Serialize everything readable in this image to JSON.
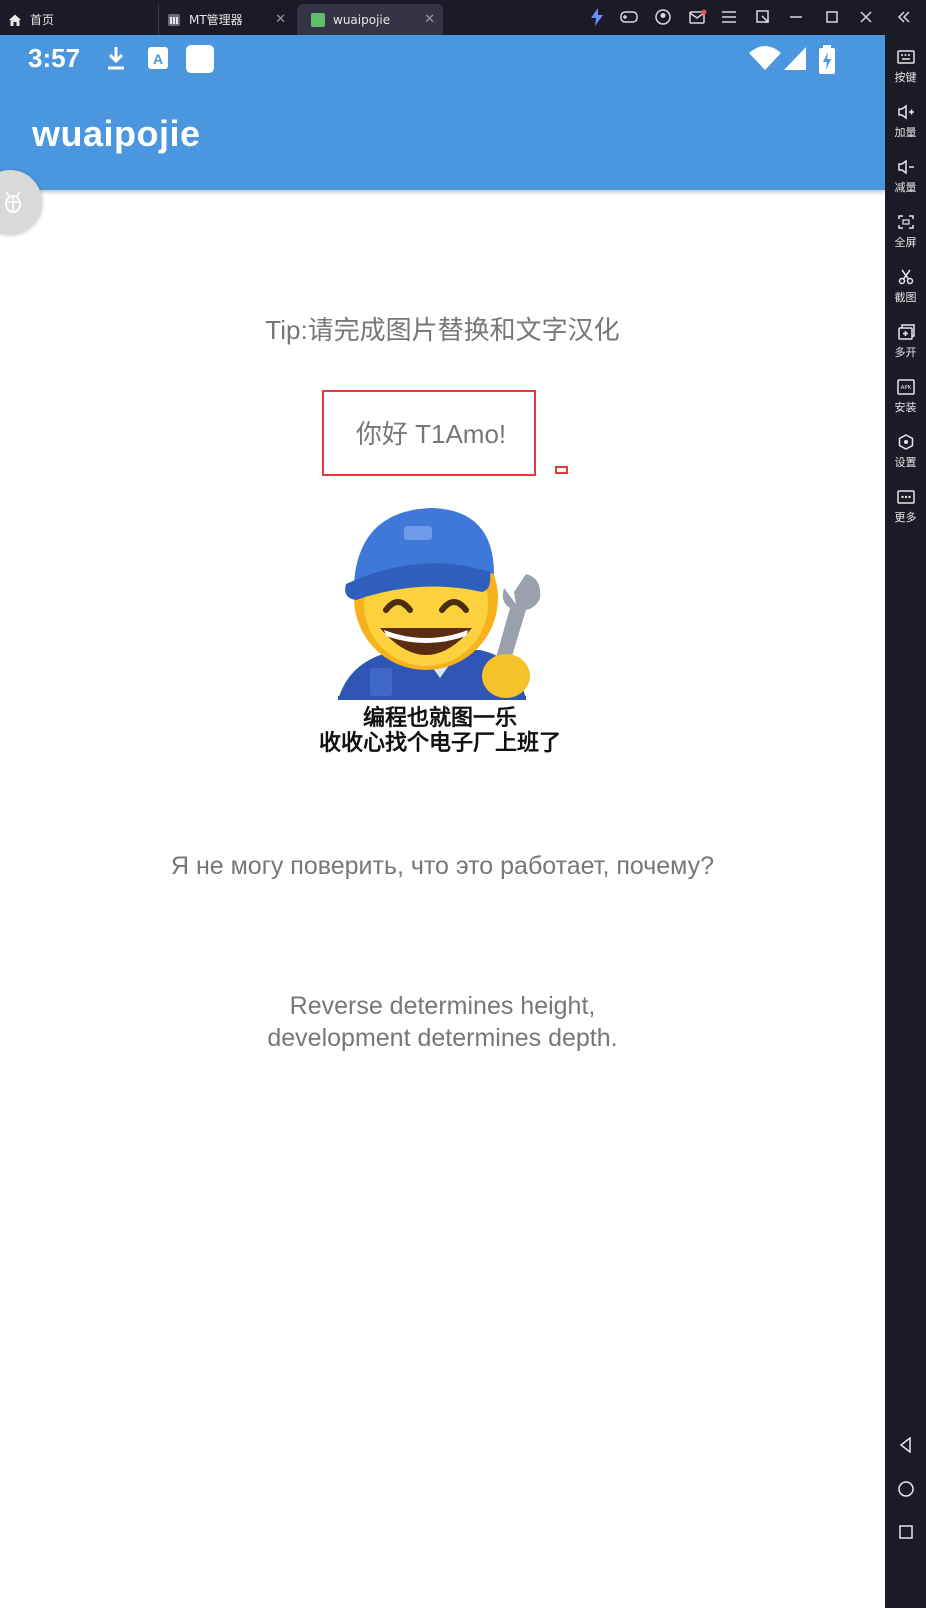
{
  "emulator": {
    "tabs": [
      {
        "label": "首页",
        "icon": "home-icon"
      },
      {
        "label": "MT管理器",
        "icon": "mt-manager-app-icon"
      },
      {
        "label": "wuaipojie",
        "icon": "android-app-icon"
      }
    ],
    "sidebar": [
      {
        "label": "按键",
        "icon": "keyboard-icon"
      },
      {
        "label": "加量",
        "icon": "volume-up-icon"
      },
      {
        "label": "减量",
        "icon": "volume-down-icon"
      },
      {
        "label": "全屏",
        "icon": "fullscreen-icon"
      },
      {
        "label": "截图",
        "icon": "scissors-icon"
      },
      {
        "label": "多开",
        "icon": "multi-instance-icon"
      },
      {
        "label": "安装",
        "icon": "apk-install-icon"
      },
      {
        "label": "设置",
        "icon": "settings-icon"
      },
      {
        "label": "更多",
        "icon": "more-icon"
      }
    ]
  },
  "phone": {
    "status_bar": {
      "time": "3:57",
      "accent_color": "#4a97df"
    },
    "app_bar": {
      "title": "wuaipojie"
    },
    "content": {
      "tip": "Tip:请完成图片替换和文字汉化",
      "greeting": "你好 T1Amo!",
      "meme_caption_line1": "编程也就图一乐",
      "meme_caption_line2": "收收心找个电子厂上班了",
      "russian_text": "Я не могу поверить, что это работает, почему?",
      "reverse_line1": "Reverse determines height,",
      "reverse_line2": "development determines depth."
    }
  }
}
